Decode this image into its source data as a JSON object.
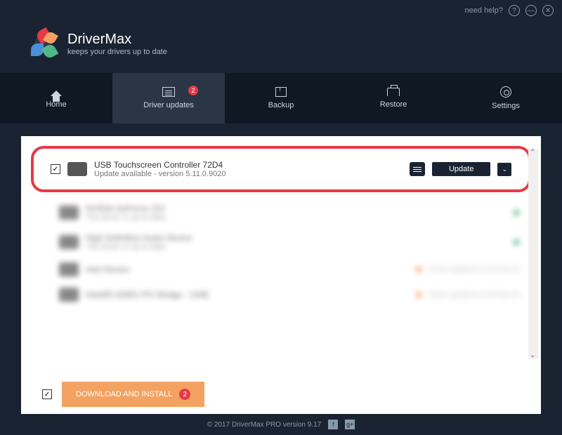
{
  "titlebar": {
    "help": "need help?"
  },
  "brand": {
    "name": "DriverMax",
    "tagline": "keeps your drivers up to date"
  },
  "tabs": {
    "home": "Home",
    "updates": "Driver updates",
    "updates_badge": "2",
    "backup": "Backup",
    "restore": "Restore",
    "settings": "Settings"
  },
  "driver": {
    "name": "USB Touchscreen Controller 72D4",
    "status": "Update available - version 5.11.0.9020",
    "update_btn": "Update"
  },
  "blurred": [
    {
      "name": "NVIDIA GeForce 210",
      "sub": "The driver is up-to-date"
    },
    {
      "name": "High Definition Audio Device",
      "sub": "The driver is up-to-date"
    },
    {
      "name": "Intel Device",
      "sub": "",
      "meta": "Driver updated on 03-Nov-16"
    },
    {
      "name": "Intel(R) 82801 PCI Bridge - 244E",
      "sub": "",
      "meta": "Driver updated on 03-Nov-16"
    }
  ],
  "install": {
    "label": "DOWNLOAD AND INSTALL",
    "badge": "2"
  },
  "footer": {
    "copyright": "© 2017 DriverMax PRO version 9.17"
  }
}
